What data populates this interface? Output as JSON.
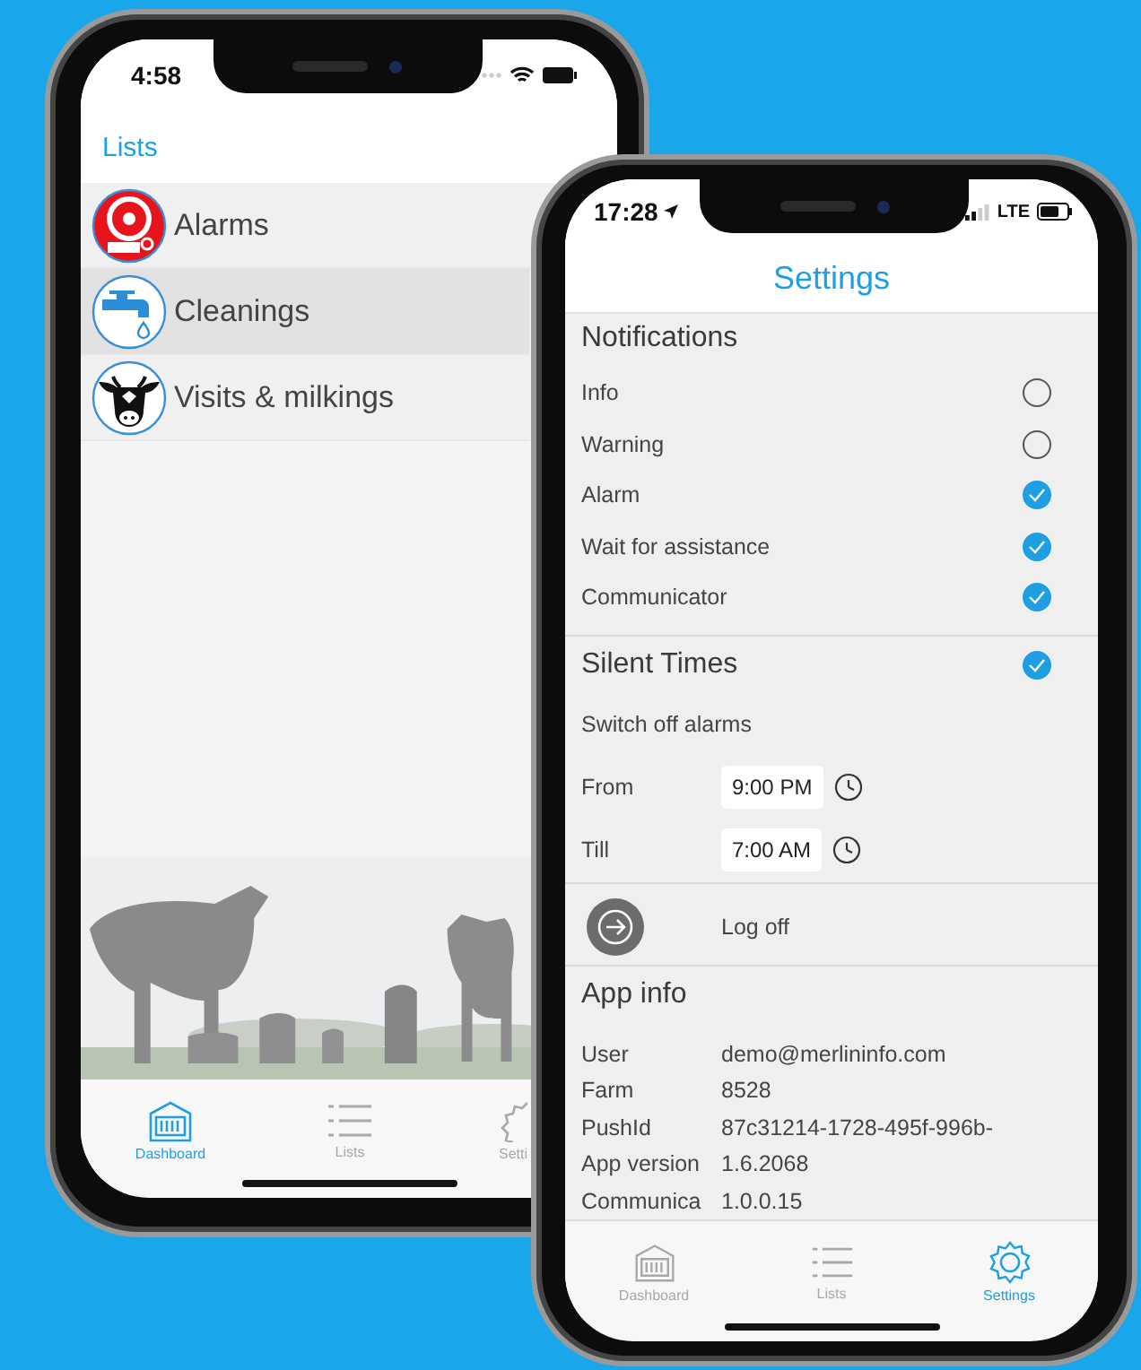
{
  "lists_screen": {
    "status_time": "4:58",
    "title": "Lists",
    "items": [
      {
        "label": "Alarms",
        "selected": false
      },
      {
        "label": "Cleanings",
        "selected": true
      },
      {
        "label": "Visits & milkings",
        "selected": false
      }
    ],
    "tabs": [
      {
        "label": "Dashboard",
        "selected": true
      },
      {
        "label": "Lists",
        "selected": false
      },
      {
        "label": "Setti",
        "selected": false
      }
    ]
  },
  "settings_screen": {
    "status_time": "17:28",
    "network": "LTE",
    "title": "Settings",
    "notifications": {
      "heading": "Notifications",
      "options": [
        {
          "label": "Info",
          "checked": false
        },
        {
          "label": "Warning",
          "checked": false
        },
        {
          "label": "Alarm",
          "checked": true
        },
        {
          "label": "Wait for assistance",
          "checked": true
        },
        {
          "label": "Communicator",
          "checked": true
        }
      ]
    },
    "silent_times": {
      "heading": "Silent Times",
      "checked": true,
      "subtitle": "Switch off alarms",
      "times": [
        {
          "label": "From",
          "value": "9:00 PM"
        },
        {
          "label": "Till",
          "value": "7:00 AM"
        }
      ]
    },
    "log_off": {
      "label": "Log off"
    },
    "app_info": {
      "heading": "App info",
      "rows": [
        {
          "label": "User",
          "value": "demo@merlininfo.com"
        },
        {
          "label": "Farm",
          "value": "8528"
        },
        {
          "label": "PushId",
          "value": "87c31214-1728-495f-996b-"
        },
        {
          "label": "App version",
          "value": "1.6.2068"
        },
        {
          "label": "Communica",
          "value": "1.0.0.15"
        }
      ]
    },
    "tabs": [
      {
        "label": "Dashboard",
        "selected": false
      },
      {
        "label": "Lists",
        "selected": false
      },
      {
        "label": "Settings",
        "selected": true
      }
    ]
  }
}
